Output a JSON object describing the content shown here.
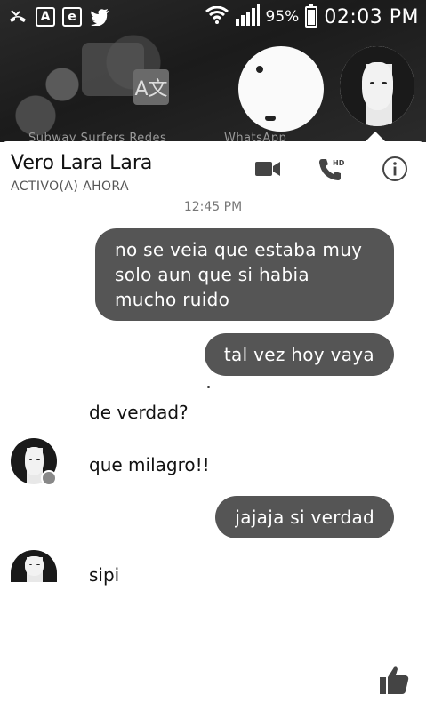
{
  "status_bar": {
    "battery_percent": "95%",
    "time": "02:03 PM",
    "left_icons": [
      "missed-call-icon",
      "app-tile-icon",
      "app-tile-e-icon",
      "twitter-icon"
    ]
  },
  "wallpaper": {
    "translate_glyph": "A文",
    "labels": [
      "Subway Surfers Redes",
      "WhatsApp"
    ]
  },
  "chat": {
    "contact_name": "Vero Lara Lara",
    "contact_status": "ACTIVO(A) AHORA",
    "timestamp": "12:45 PM",
    "messages": [
      {
        "from": "me",
        "text": "no se veia que estaba muy solo aun que si habia mucho ruido"
      },
      {
        "from": "me",
        "text": "tal vez hoy vaya"
      },
      {
        "from": "them",
        "text": "de verdad?"
      },
      {
        "from": "them",
        "text": "que milagro!!"
      },
      {
        "from": "me",
        "text": "jajaja si verdad"
      },
      {
        "from": "them",
        "text": "sipi"
      }
    ]
  },
  "colors": {
    "outgoing_bubble": "#555555",
    "panel": "#ffffff",
    "wallpaper": "#1f1f1f"
  }
}
